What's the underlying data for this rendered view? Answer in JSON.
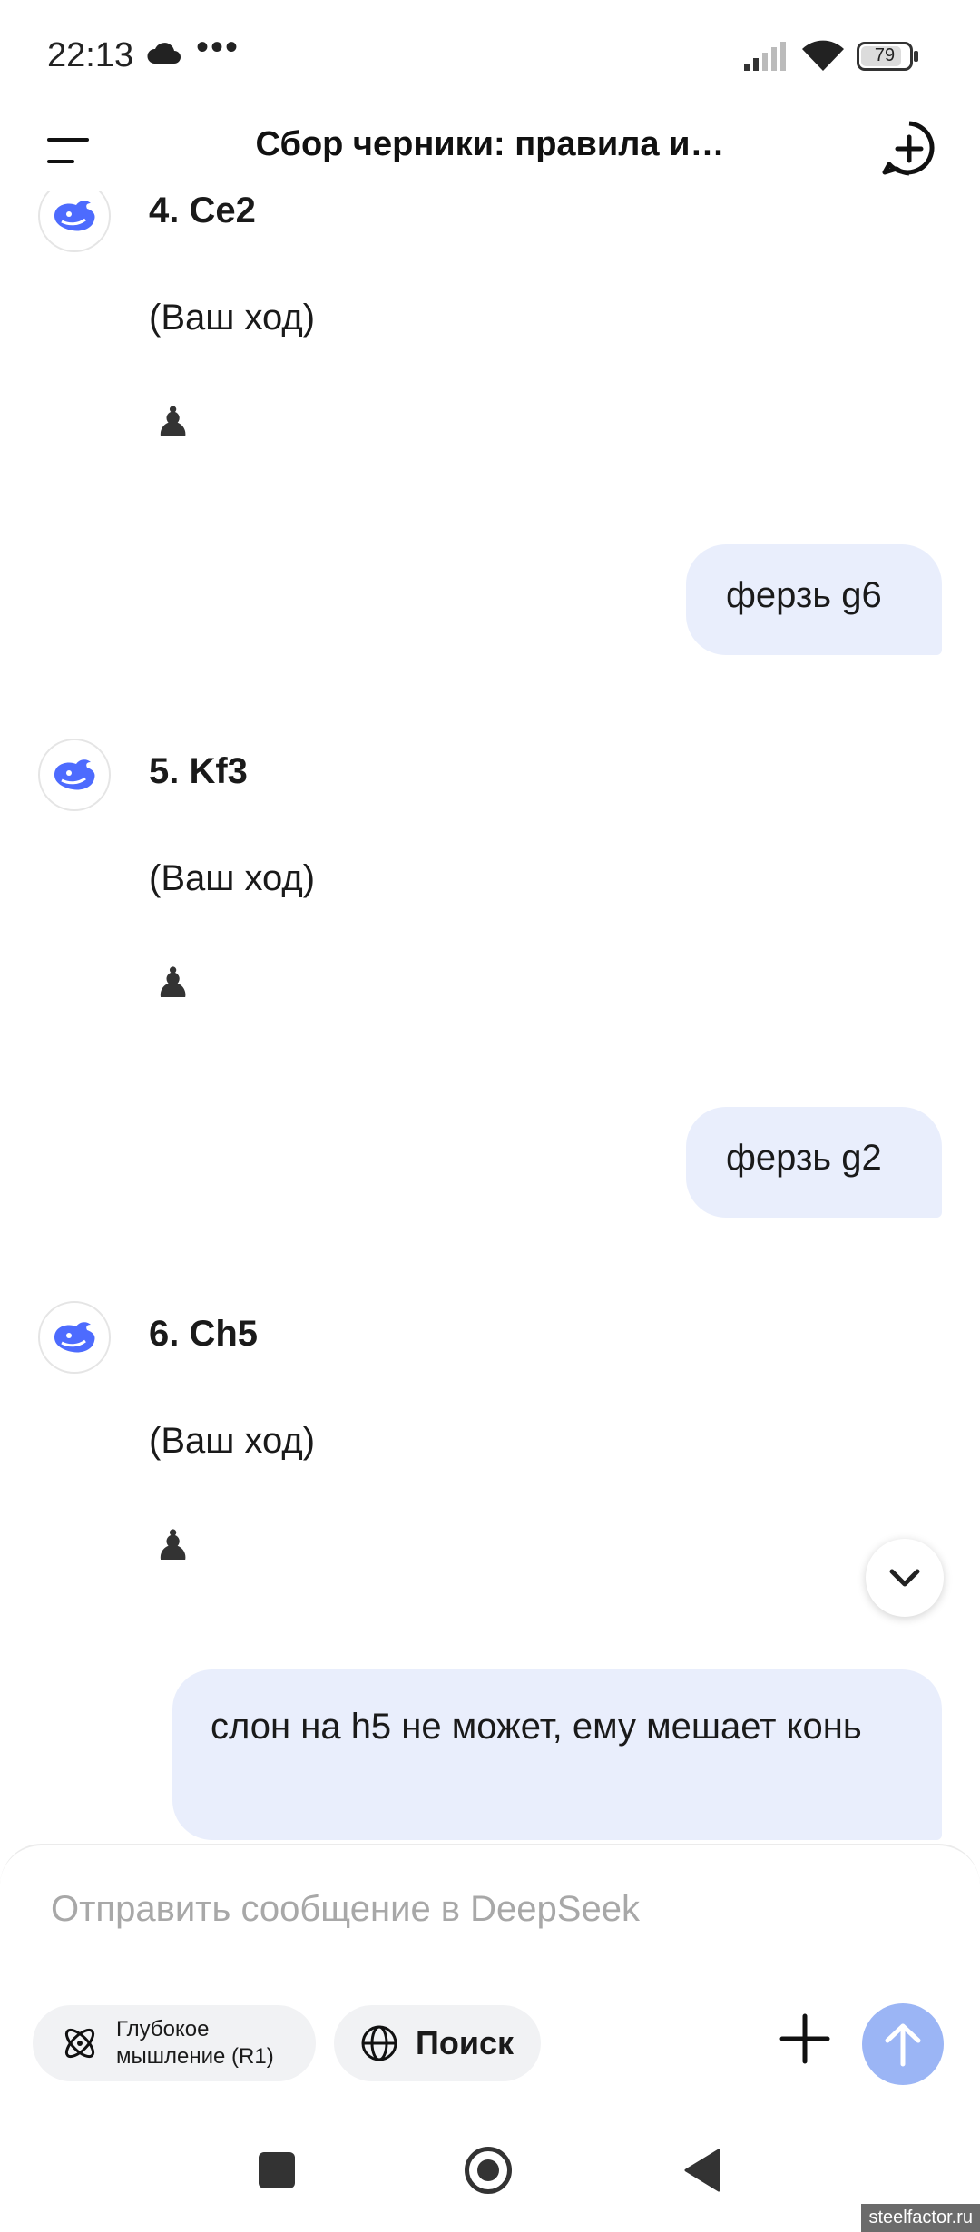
{
  "status_bar": {
    "time": "22:13",
    "dots": "•••",
    "battery": "79"
  },
  "header": {
    "title": "Сбор черники: правила и…"
  },
  "messages": [
    {
      "role": "assistant",
      "move": "4. Се2",
      "note": "(Ваш ход)",
      "piece": "♟"
    },
    {
      "role": "user",
      "text": "ферзь g6"
    },
    {
      "role": "assistant",
      "move": "5. Kf3",
      "note": "(Ваш ход)",
      "piece": "♟"
    },
    {
      "role": "user",
      "text": "ферзь g2"
    },
    {
      "role": "assistant",
      "move": "6. Ch5",
      "note": "(Ваш ход)",
      "piece": "♟"
    },
    {
      "role": "user",
      "text": "слон на h5  не может, ему мешает конь"
    }
  ],
  "composer": {
    "placeholder": "Отправить сообщение в DeepSeek",
    "deep_think_label": "Глубокое мышление (R1)",
    "search_label": "Поиск"
  },
  "watermark": "steelfactor.ru",
  "colors": {
    "accent": "#4d6bfe",
    "user_bubble": "#e9eefc",
    "send_button": "#9bb5f5"
  }
}
